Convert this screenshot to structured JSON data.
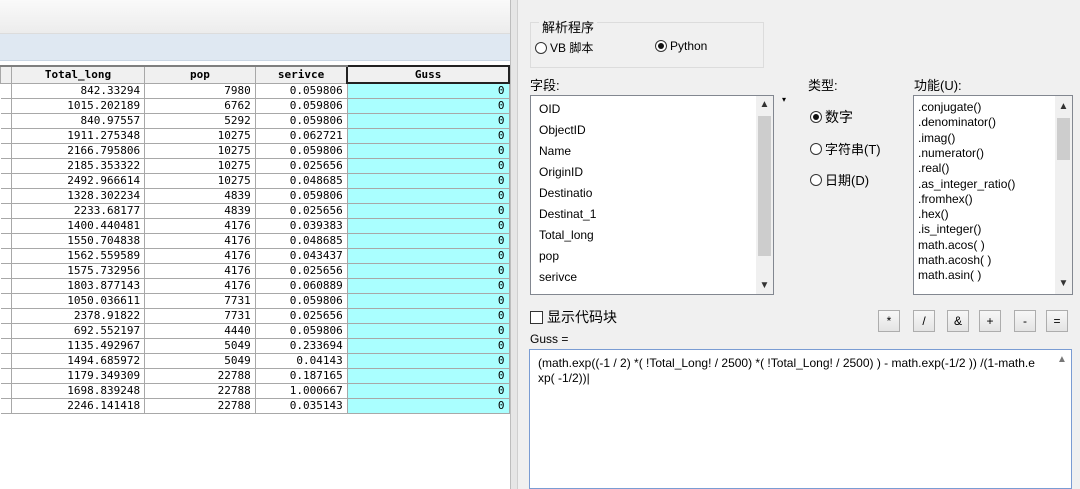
{
  "table": {
    "headers": [
      "Total_long",
      "pop",
      "serivce",
      "Guss"
    ],
    "rows": [
      [
        "842.33294",
        "7980",
        "0.059806",
        "0"
      ],
      [
        "1015.202189",
        "6762",
        "0.059806",
        "0"
      ],
      [
        "840.97557",
        "5292",
        "0.059806",
        "0"
      ],
      [
        "1911.275348",
        "10275",
        "0.062721",
        "0"
      ],
      [
        "2166.795806",
        "10275",
        "0.059806",
        "0"
      ],
      [
        "2185.353322",
        "10275",
        "0.025656",
        "0"
      ],
      [
        "2492.966614",
        "10275",
        "0.048685",
        "0"
      ],
      [
        "1328.302234",
        "4839",
        "0.059806",
        "0"
      ],
      [
        "2233.68177",
        "4839",
        "0.025656",
        "0"
      ],
      [
        "1400.440481",
        "4176",
        "0.039383",
        "0"
      ],
      [
        "1550.704838",
        "4176",
        "0.048685",
        "0"
      ],
      [
        "1562.559589",
        "4176",
        "0.043437",
        "0"
      ],
      [
        "1575.732956",
        "4176",
        "0.025656",
        "0"
      ],
      [
        "1803.877143",
        "4176",
        "0.060889",
        "0"
      ],
      [
        "1050.036611",
        "7731",
        "0.059806",
        "0"
      ],
      [
        "2378.91822",
        "7731",
        "0.025656",
        "0"
      ],
      [
        "692.552197",
        "4440",
        "0.059806",
        "0"
      ],
      [
        "1135.492967",
        "5049",
        "0.233694",
        "0"
      ],
      [
        "1494.685972",
        "5049",
        "0.04143",
        "0"
      ],
      [
        "1179.349309",
        "22788",
        "0.187165",
        "0"
      ],
      [
        "1698.839248",
        "22788",
        "1.000667",
        "0"
      ],
      [
        "2246.141418",
        "22788",
        "0.035143",
        "0"
      ]
    ]
  },
  "parser": {
    "title": "解析程序",
    "options": [
      {
        "label": "VB 脚本",
        "selected": false
      },
      {
        "label": "Python",
        "selected": true
      }
    ]
  },
  "fields": {
    "label": "字段:",
    "items": [
      "OID",
      "ObjectID",
      "Name",
      "OriginID",
      "Destinatio",
      "Destinat_1",
      "Total_long",
      "pop",
      "serivce"
    ]
  },
  "types": {
    "label": "类型:",
    "options": [
      {
        "label": "数字",
        "selected": true
      },
      {
        "label": "字符串(T)",
        "selected": false
      },
      {
        "label": "日期(D)",
        "selected": false
      }
    ]
  },
  "functions": {
    "label": "功能(U):",
    "items": [
      ".conjugate()",
      ".denominator()",
      ".imag()",
      ".numerator()",
      ".real()",
      ".as_integer_ratio()",
      ".fromhex()",
      ".hex()",
      ".is_integer()",
      "math.acos( )",
      "math.acosh( )",
      "math.asin( )"
    ]
  },
  "codeblock": {
    "label": "显示代码块",
    "checked": false
  },
  "operators": [
    "*",
    "/",
    "&",
    "+",
    "-",
    "="
  ],
  "expression": {
    "label": "Guss =",
    "text": "(math.exp((-1 / 2) *( !Total_Long! / 2500) *( !Total_Long! / 2500) ) - math.exp(-1/2 )) /(1-math.exp( -1/2))|"
  }
}
